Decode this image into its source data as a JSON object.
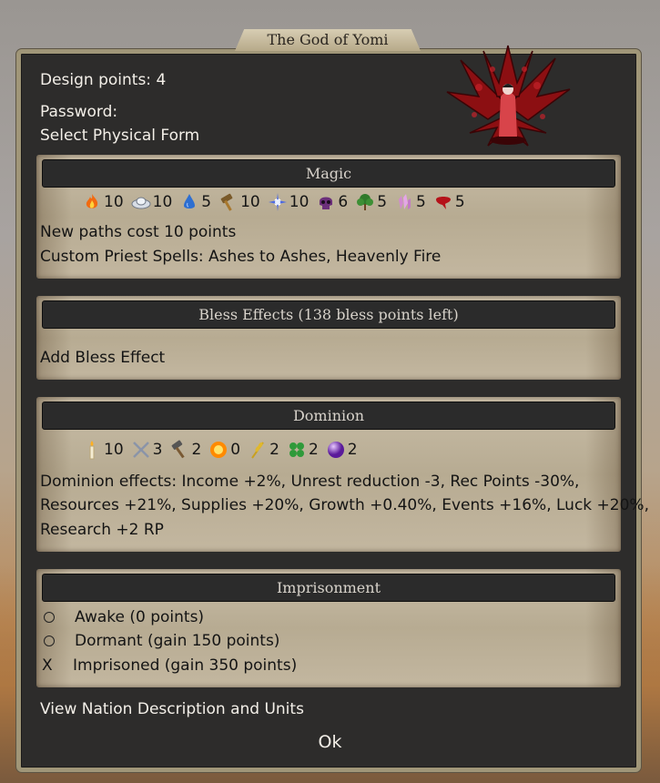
{
  "window": {
    "title": "The God of Yomi"
  },
  "header": {
    "design_points": "Design points: 4",
    "password": "Password:",
    "select_form": "Select Physical Form"
  },
  "magic": {
    "title": "Magic",
    "paths": [
      {
        "icon": "fire-icon",
        "value": "10"
      },
      {
        "icon": "air-icon",
        "value": "10"
      },
      {
        "icon": "water-icon",
        "value": "5"
      },
      {
        "icon": "earth-hammer-icon",
        "value": "10"
      },
      {
        "icon": "astral-star-icon",
        "value": "10"
      },
      {
        "icon": "death-skull-icon",
        "value": "6"
      },
      {
        "icon": "nature-tree-icon",
        "value": "5"
      },
      {
        "icon": "glamour-crystal-icon",
        "value": "5"
      },
      {
        "icon": "blood-icon",
        "value": "5"
      }
    ],
    "new_paths_cost": "New paths cost 10 points",
    "custom_priest": "Custom Priest Spells: Ashes to Ashes, Heavenly Fire"
  },
  "bless": {
    "title": "Bless Effects (138 bless points left)",
    "add": "Add Bless Effect"
  },
  "dominion": {
    "title": "Dominion",
    "values": [
      {
        "icon": "candle-icon",
        "value": "10"
      },
      {
        "icon": "crossed-swords-icon",
        "value": "3"
      },
      {
        "icon": "hammer-icon",
        "value": "2"
      },
      {
        "icon": "sun-icon",
        "value": "0"
      },
      {
        "icon": "wheat-icon",
        "value": "2"
      },
      {
        "icon": "clover-icon",
        "value": "2"
      },
      {
        "icon": "magic-orb-icon",
        "value": "2"
      }
    ],
    "effects_line1": "Dominion effects: Income +2%, Unrest reduction -3, Rec Points -30%,",
    "effects_line2": "Resources +21%, Supplies +20%, Growth +0.40%, Events +16%, Luck +20%,",
    "effects_line3": "Research +2 RP"
  },
  "imprisonment": {
    "title": "Imprisonment",
    "options": [
      {
        "mark": "",
        "label": "Awake (0 points)",
        "selected": false
      },
      {
        "mark": "",
        "label": "Dormant (gain 150 points)",
        "selected": false
      },
      {
        "mark": "X",
        "label": "Imprisoned (gain 350 points)",
        "selected": true
      }
    ]
  },
  "footer": {
    "view_nation": "View Nation Description and Units",
    "ok": "Ok"
  },
  "colors": {
    "panel": "#c1b59d",
    "header_bar": "#2b2b2b",
    "dialog": "#2d2c2b",
    "frame": "#a09678"
  }
}
